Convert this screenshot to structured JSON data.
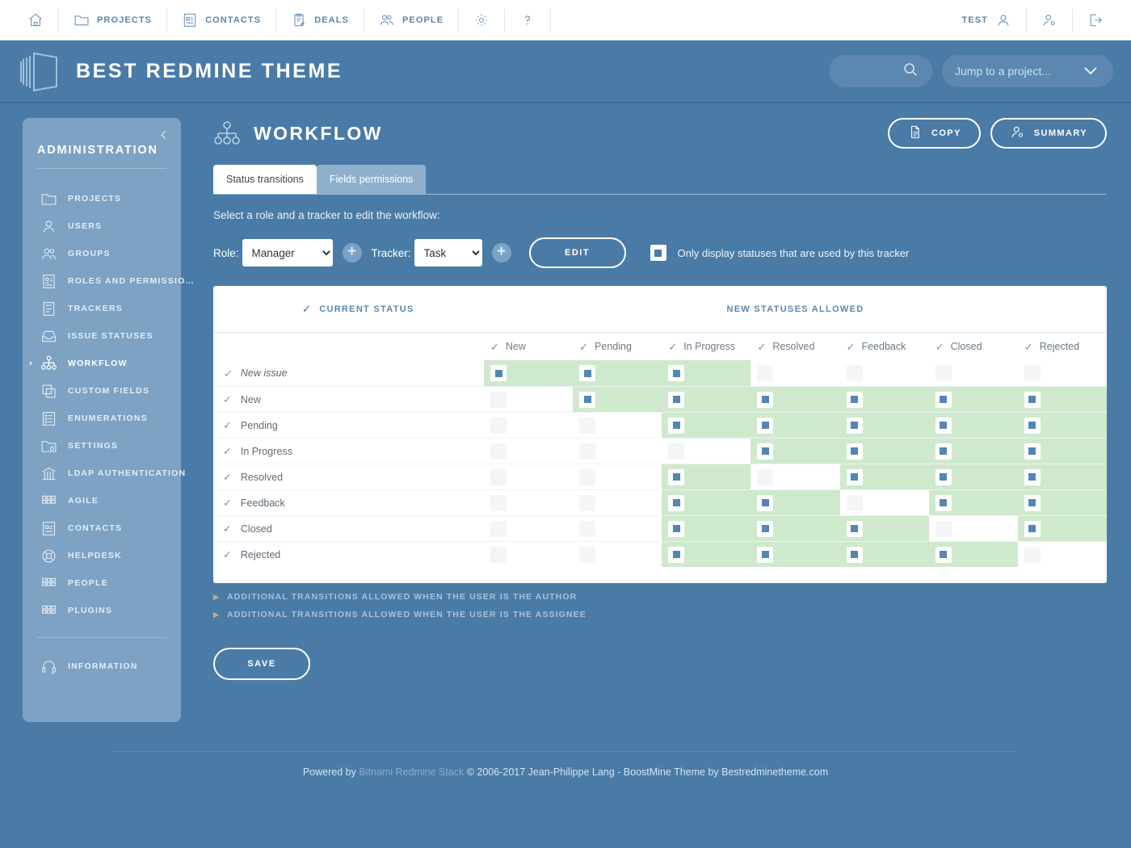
{
  "topnav": {
    "items": [
      {
        "label": "",
        "icon": "home-icon",
        "name": "home"
      },
      {
        "label": "PROJECTS",
        "icon": "folder-icon",
        "name": "projects"
      },
      {
        "label": "CONTACTS",
        "icon": "contact-card-icon",
        "name": "contacts"
      },
      {
        "label": "DEALS",
        "icon": "clipboard-pencil-icon",
        "name": "deals"
      },
      {
        "label": "PEOPLE",
        "icon": "people-icon",
        "name": "people"
      },
      {
        "label": "",
        "icon": "gear-icon",
        "name": "settings"
      },
      {
        "label": "",
        "icon": "question-mark-icon",
        "name": "help"
      }
    ],
    "user_label": "TEST",
    "user_icon": "user-icon",
    "account_icon": "user-gear-icon",
    "logout_icon": "logout-arrow-icon"
  },
  "brand": {
    "title": "BEST REDMINE THEME",
    "logo_icon": "book-stack-icon",
    "search_icon": "search-icon",
    "search_placeholder": "",
    "jump_placeholder": "Jump to a project...",
    "jump_icon": "chevron-down-icon"
  },
  "sidebar": {
    "title": "ADMINISTRATION",
    "collapse_icon": "chevron-left-icon",
    "items": [
      {
        "label": "PROJECTS",
        "icon": "folder-icon",
        "active": false
      },
      {
        "label": "USERS",
        "icon": "user-icon",
        "active": false
      },
      {
        "label": "GROUPS",
        "icon": "group-icon",
        "active": false
      },
      {
        "label": "ROLES AND PERMISSIO…",
        "icon": "id-card-icon",
        "active": false
      },
      {
        "label": "TRACKERS",
        "icon": "list-panel-icon",
        "active": false
      },
      {
        "label": "ISSUE STATUSES",
        "icon": "tray-icon",
        "active": false
      },
      {
        "label": "WORKFLOW",
        "icon": "workflow-icon",
        "active": true
      },
      {
        "label": "CUSTOM FIELDS",
        "icon": "copy-icon",
        "active": false
      },
      {
        "label": "ENUMERATIONS",
        "icon": "list-icon",
        "active": false
      },
      {
        "label": "SETTINGS",
        "icon": "folder-gear-icon",
        "active": false
      },
      {
        "label": "LDAP AUTHENTICATION",
        "icon": "bank-icon",
        "active": false
      },
      {
        "label": "AGILE",
        "icon": "grid-icon",
        "active": false
      },
      {
        "label": "CONTACTS",
        "icon": "contact-card-icon",
        "active": false
      },
      {
        "label": "HELPDESK",
        "icon": "lifebuoy-icon",
        "active": false
      },
      {
        "label": "PEOPLE",
        "icon": "grid-icon",
        "active": false
      },
      {
        "label": "PLUGINS",
        "icon": "grid-icon",
        "active": false
      }
    ],
    "footer_items": [
      {
        "label": "INFORMATION",
        "icon": "headset-icon",
        "active": false
      }
    ]
  },
  "page": {
    "title": "WORKFLOW",
    "title_icon": "workflow-icon",
    "copy_label": "COPY",
    "copy_icon": "document-icon",
    "summary_label": "SUMMARY",
    "summary_icon": "user-gear-icon",
    "tabs": [
      {
        "label": "Status transitions",
        "active": true
      },
      {
        "label": "Fields permissions",
        "active": false
      }
    ],
    "instruction": "Select a role and a tracker to edit the workflow:",
    "role_label": "Role:",
    "role_value": "Manager",
    "role_options": [
      "Manager"
    ],
    "tracker_label": "Tracker:",
    "tracker_value": "Task",
    "tracker_options": [
      "Task"
    ],
    "add_icon": "plus-icon",
    "edit_label": "EDIT",
    "only_display_label": "Only display statuses that are used by this tracker",
    "only_display_checked": true,
    "save_label": "SAVE",
    "extra_sections": [
      "ADDITIONAL TRANSITIONS ALLOWED WHEN THE USER IS THE AUTHOR",
      "ADDITIONAL TRANSITIONS ALLOWED WHEN THE USER IS THE ASSIGNEE"
    ]
  },
  "table": {
    "current_status_header": "CURRENT STATUS",
    "new_statuses_header": "NEW STATUSES ALLOWED",
    "columns": [
      "New",
      "Pending",
      "In Progress",
      "Resolved",
      "Feedback",
      "Closed",
      "Rejected"
    ],
    "rows": [
      {
        "label": "New issue",
        "italic": true,
        "cells": [
          {
            "checked": true,
            "highlight": true
          },
          {
            "checked": true,
            "highlight": true
          },
          {
            "checked": true,
            "highlight": true
          },
          {
            "checked": false,
            "highlight": false
          },
          {
            "checked": false,
            "highlight": false
          },
          {
            "checked": false,
            "highlight": false
          },
          {
            "checked": false,
            "highlight": false
          }
        ]
      },
      {
        "label": "New",
        "italic": false,
        "cells": [
          {
            "checked": false,
            "highlight": false
          },
          {
            "checked": true,
            "highlight": true
          },
          {
            "checked": true,
            "highlight": true
          },
          {
            "checked": true,
            "highlight": true
          },
          {
            "checked": true,
            "highlight": true
          },
          {
            "checked": true,
            "highlight": true
          },
          {
            "checked": true,
            "highlight": true
          }
        ]
      },
      {
        "label": "Pending",
        "italic": false,
        "cells": [
          {
            "checked": false,
            "highlight": false
          },
          {
            "checked": false,
            "highlight": false
          },
          {
            "checked": true,
            "highlight": true
          },
          {
            "checked": true,
            "highlight": true
          },
          {
            "checked": true,
            "highlight": true
          },
          {
            "checked": true,
            "highlight": true
          },
          {
            "checked": true,
            "highlight": true
          }
        ]
      },
      {
        "label": "In Progress",
        "italic": false,
        "cells": [
          {
            "checked": false,
            "highlight": false
          },
          {
            "checked": false,
            "highlight": false
          },
          {
            "checked": false,
            "highlight": false
          },
          {
            "checked": true,
            "highlight": true
          },
          {
            "checked": true,
            "highlight": true
          },
          {
            "checked": true,
            "highlight": true
          },
          {
            "checked": true,
            "highlight": true
          }
        ]
      },
      {
        "label": "Resolved",
        "italic": false,
        "cells": [
          {
            "checked": false,
            "highlight": false
          },
          {
            "checked": false,
            "highlight": false
          },
          {
            "checked": true,
            "highlight": true
          },
          {
            "checked": false,
            "highlight": false
          },
          {
            "checked": true,
            "highlight": true
          },
          {
            "checked": true,
            "highlight": true
          },
          {
            "checked": true,
            "highlight": true
          }
        ]
      },
      {
        "label": "Feedback",
        "italic": false,
        "cells": [
          {
            "checked": false,
            "highlight": false
          },
          {
            "checked": false,
            "highlight": false
          },
          {
            "checked": true,
            "highlight": true
          },
          {
            "checked": true,
            "highlight": true
          },
          {
            "checked": false,
            "highlight": false
          },
          {
            "checked": true,
            "highlight": true
          },
          {
            "checked": true,
            "highlight": true
          }
        ]
      },
      {
        "label": "Closed",
        "italic": false,
        "cells": [
          {
            "checked": false,
            "highlight": false
          },
          {
            "checked": false,
            "highlight": false
          },
          {
            "checked": true,
            "highlight": true
          },
          {
            "checked": true,
            "highlight": true
          },
          {
            "checked": true,
            "highlight": true
          },
          {
            "checked": false,
            "highlight": false
          },
          {
            "checked": true,
            "highlight": true
          }
        ]
      },
      {
        "label": "Rejected",
        "italic": false,
        "cells": [
          {
            "checked": false,
            "highlight": false
          },
          {
            "checked": false,
            "highlight": false
          },
          {
            "checked": true,
            "highlight": true
          },
          {
            "checked": true,
            "highlight": true
          },
          {
            "checked": true,
            "highlight": true
          },
          {
            "checked": true,
            "highlight": true
          },
          {
            "checked": false,
            "highlight": false
          }
        ]
      }
    ]
  },
  "footer": {
    "prefix": "Powered by ",
    "link": "Bitnami Redmine Stack",
    "suffix": " © 2006-2017 Jean-Philippe Lang - BoostMine Theme by Bestredminetheme.com"
  },
  "colors": {
    "page_bg": "#4a7ba7",
    "sidebar_bg": "#7ea2c4",
    "accent": "#5b86ad",
    "highlight_green": "#cfe9cd",
    "checkbox_blue": "#5486b5"
  }
}
